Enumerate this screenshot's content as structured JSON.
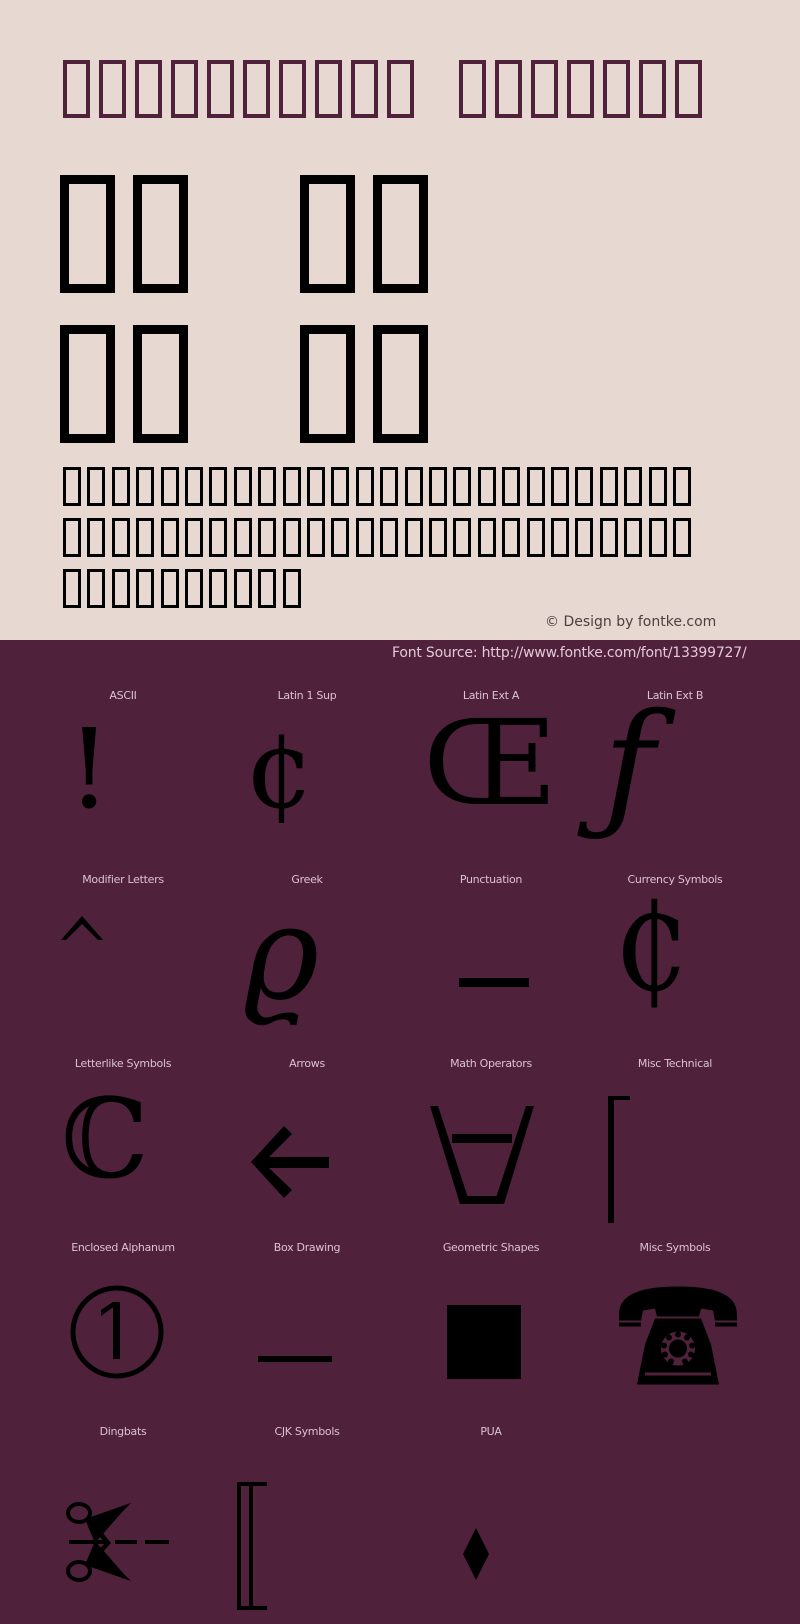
{
  "preview": {
    "title_tofu_groups": [
      10,
      7
    ],
    "big_tofu_rows": [
      [
        2,
        2
      ],
      [
        2,
        2
      ]
    ],
    "small_tofu_rows": [
      26,
      26,
      10
    ],
    "credit": "© Design by fontke.com",
    "colors": {
      "background": "#e8d8d2",
      "title": "#4f213b",
      "glyph": "#000000",
      "credit": "#4a4040"
    }
  },
  "source": {
    "text": "Font Source: http://www.fontke.com/font/13399727/"
  },
  "grid": {
    "background": "#4f213b",
    "label_color": "#d9c4cf",
    "cells": [
      {
        "label": "ASCII",
        "glyph": "!",
        "glyph_name": "exclamation-mark"
      },
      {
        "label": "Latin 1 Sup",
        "glyph": "¢",
        "glyph_name": "cent-sign"
      },
      {
        "label": "Latin Ext A",
        "glyph": "Œ",
        "glyph_name": "oe-ligature"
      },
      {
        "label": "Latin Ext B",
        "glyph": "ƒ",
        "glyph_name": "f-hook"
      },
      {
        "label": "Modifier Letters",
        "glyph": "ˆ",
        "glyph_name": "circumflex"
      },
      {
        "label": "Greek",
        "glyph": "ϱ",
        "glyph_name": "rho-symbol"
      },
      {
        "label": "Punctuation",
        "glyph": "–",
        "glyph_name": "en-dash"
      },
      {
        "label": "Currency Symbols",
        "glyph": "₵",
        "glyph_name": "cedi-sign"
      },
      {
        "label": "Letterlike Symbols",
        "glyph": "ℂ",
        "glyph_name": "double-struck-c"
      },
      {
        "label": "Arrows",
        "glyph": "←",
        "glyph_name": "left-arrow"
      },
      {
        "label": "Math Operators",
        "glyph": "∀",
        "glyph_name": "for-all"
      },
      {
        "label": "Misc Technical",
        "glyph": "⎡",
        "glyph_name": "left-square-bracket-upper"
      },
      {
        "label": "Enclosed Alphanum",
        "glyph": "①",
        "glyph_name": "circled-one"
      },
      {
        "label": "Box Drawing",
        "glyph": "─",
        "glyph_name": "box-horizontal"
      },
      {
        "label": "Geometric Shapes",
        "glyph": "■",
        "glyph_name": "black-square"
      },
      {
        "label": "Misc Symbols",
        "glyph": "☎",
        "glyph_name": "telephone"
      },
      {
        "label": "Dingbats",
        "glyph": "✂",
        "glyph_name": "scissors"
      },
      {
        "label": "CJK Symbols",
        "glyph": "〚",
        "glyph_name": "white-square-bracket"
      },
      {
        "label": "PUA",
        "glyph": "◆",
        "glyph_name": "diamond"
      }
    ]
  }
}
